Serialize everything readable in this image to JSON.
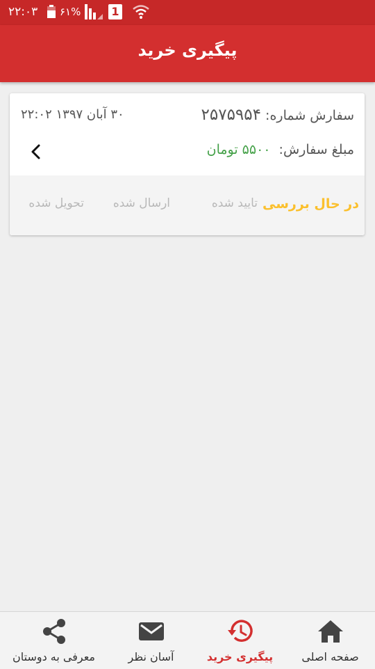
{
  "status_bar": {
    "time": "۲۲:۰۳",
    "battery_percent": "۶۱%",
    "battery_level": 0.61,
    "sim_label": "1"
  },
  "app_bar": {
    "title": "پیگیری خرید"
  },
  "order": {
    "number_label": "سفارش شماره:",
    "number": "۲۵۷۵۹۵۴",
    "date": "۳۰ آبان ۱۳۹۷  ۲۲:۰۲",
    "amount_label": "مبلغ سفارش:",
    "amount": "۵۵۰۰ تومان",
    "amount_color": "#43a047",
    "chevron_icon": "chevron-left-icon",
    "steps": [
      {
        "label": "در حال بررسی",
        "active": true
      },
      {
        "label": "تایید شده",
        "active": false
      },
      {
        "label": "ارسال شده",
        "active": false
      },
      {
        "label": "تحویل شده",
        "active": false
      }
    ],
    "active_step_color": "#fbc02d"
  },
  "bottom_nav": {
    "items": [
      {
        "label": "صفحه اصلی",
        "icon": "home-icon",
        "active": false
      },
      {
        "label": "پیگیری خرید",
        "icon": "history-icon",
        "active": true
      },
      {
        "label": "آسان نظر",
        "icon": "mail-icon",
        "active": false
      },
      {
        "label": "معرفی به دوستان",
        "icon": "share-icon",
        "active": false
      }
    ]
  },
  "colors": {
    "primary": "#d32f2f",
    "status_bar": "#c62828",
    "background": "#efefef"
  }
}
